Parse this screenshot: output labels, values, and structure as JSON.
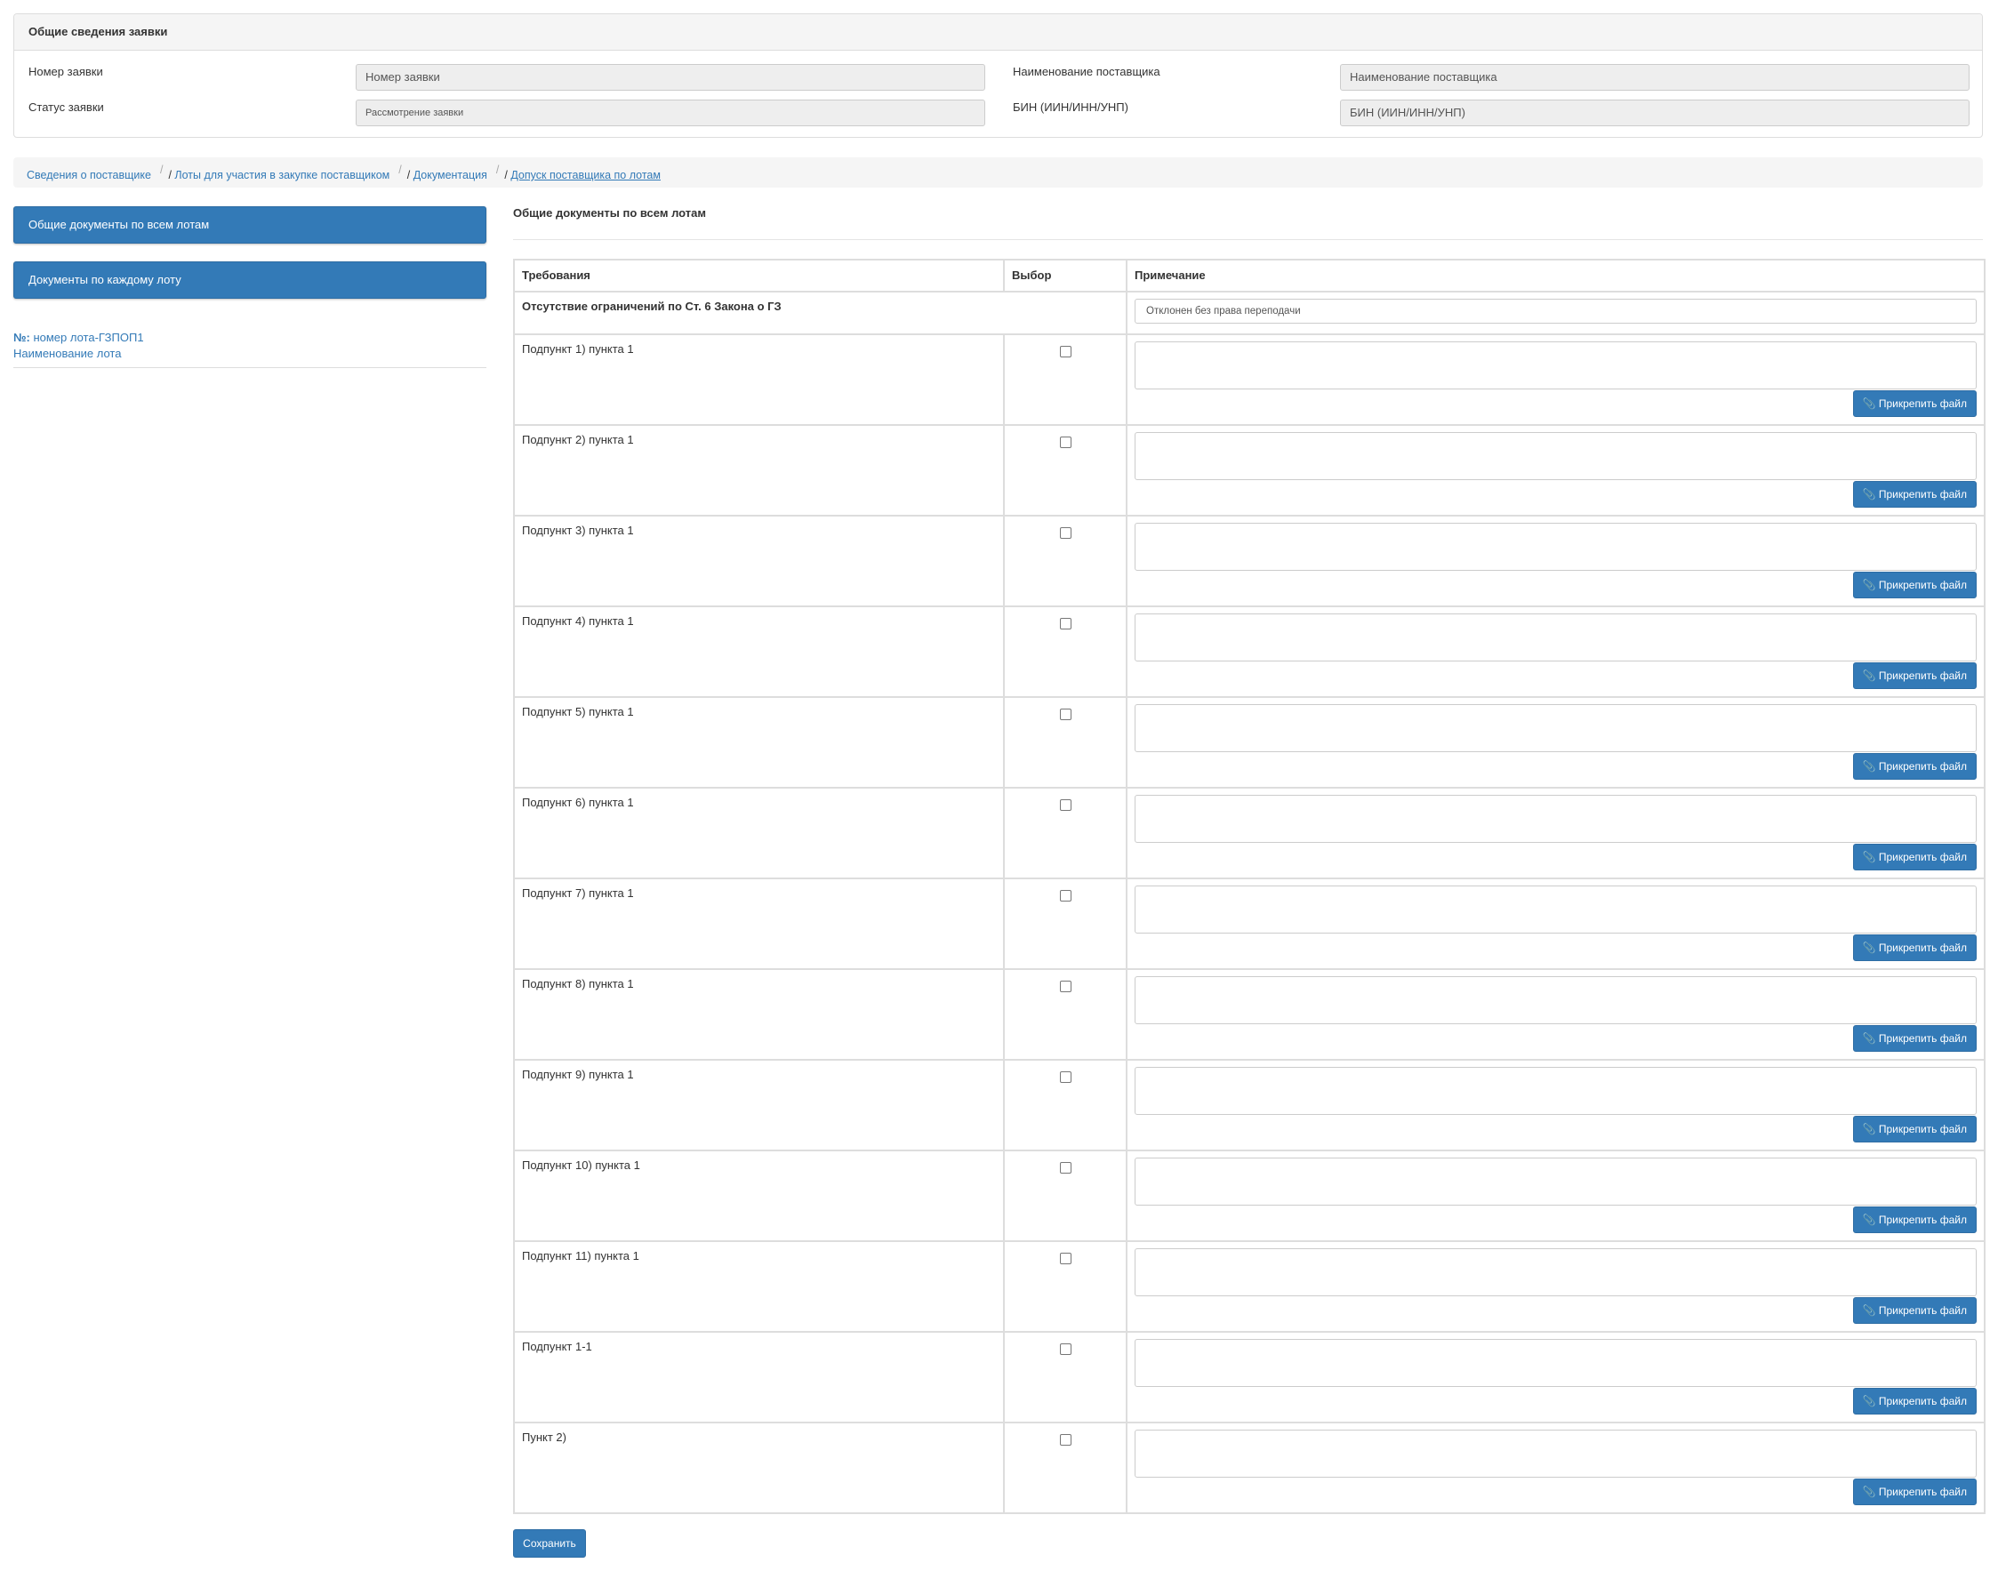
{
  "general_info": {
    "title": "Общие сведения заявки",
    "request_number_label": "Номер заявки",
    "request_number_value": "Номер заявки",
    "request_status_label": "Статус заявки",
    "request_status_value": "Рассмотрение заявки",
    "supplier_name_label": "Наименование поставщика",
    "supplier_name_value": "Наименование поставщика",
    "bin_label": "БИН (ИИН/ИНН/УНП)",
    "bin_value": "БИН (ИИН/ИНН/УНП)"
  },
  "breadcrumb": {
    "items": [
      "Сведения о поставщике",
      "Лоты для участия в закупке поставщиком",
      "Документация",
      "Допуск поставщика по лотам"
    ]
  },
  "sidebar": {
    "buttons": [
      "Общие документы по всем лотам",
      "Документы по каждому лоту"
    ],
    "lot_number_label": "№:",
    "lot_number": "номер лота-ГЗПОП1",
    "lot_name": "Наименование лота"
  },
  "main": {
    "section_title": "Общие документы по всем лотам",
    "columns": [
      "Требования",
      "Выбор",
      "Примечание"
    ],
    "group_title": "Отсутствие ограничений по Ст. 6 Закона о ГЗ",
    "group_note": "Отклонен без права переподачи",
    "attach_label": "Прикрепить файл",
    "rows": [
      "Подпункт 1) пункта 1",
      "Подпункт 2) пункта 1",
      "Подпункт 3) пункта 1",
      "Подпункт 4) пункта 1",
      "Подпункт 5) пункта 1",
      "Подпункт 6) пункта 1",
      "Подпункт 7) пункта 1",
      "Подпункт 8) пункта 1",
      "Подпункт 9) пункта 1",
      "Подпункт 10) пункта 1",
      "Подпункт 11) пункта 1",
      "Подпункт 1-1",
      "Пункт 2)"
    ],
    "save_label": "Сохранить"
  },
  "colors": {
    "primary": "#337ab7",
    "border": "#dddddd",
    "panel_bg": "#f5f5f5"
  }
}
